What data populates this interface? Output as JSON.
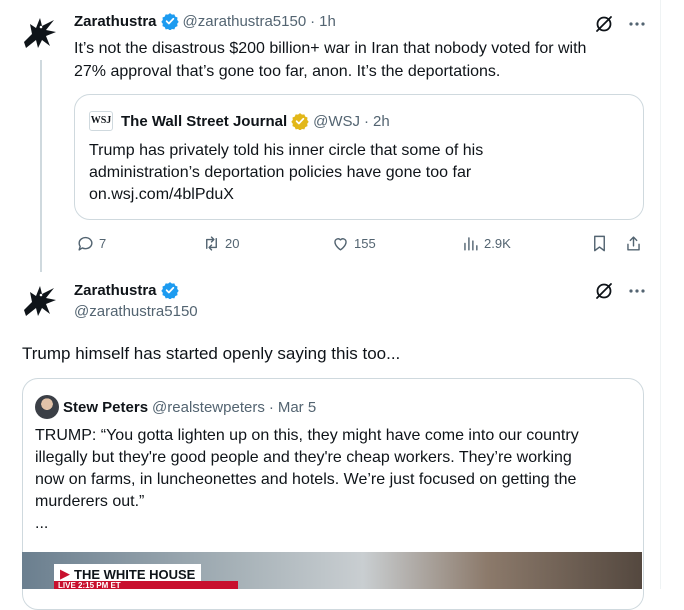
{
  "tweet1": {
    "name": "Zarathustra",
    "handle": "@zarathustra5150",
    "sep": "·",
    "time": "1h",
    "text_line1": "It’s not the disastrous $200 billion+ war in Iran that nobody voted for with",
    "text_line2": "27% approval that’s gone too far, anon. It’s the deportations.",
    "quote": {
      "logo_text": "WSJ",
      "name": "The Wall Street Journal",
      "handle": "@WSJ",
      "sep": "·",
      "time": "2h",
      "line1": "Trump has privately told his inner circle that some of his",
      "line2": "administration’s deportation policies have gone too far",
      "line3": "on.wsj.com/4blPduX"
    },
    "actions": {
      "replies": "7",
      "retweets": "20",
      "likes": "155",
      "views": "2.9K"
    }
  },
  "tweet2": {
    "name": "Zarathustra",
    "handle": "@zarathustra5150",
    "text": "Trump himself has started openly saying this too...",
    "quote": {
      "name": "Stew Peters",
      "handle": "@realstewpeters",
      "sep": "·",
      "time": "Mar 5",
      "line1": "TRUMP: “You gotta lighten up on this, they might have come into our country",
      "line2": "illegally but they're good people and they're cheap workers. They’re working",
      "line3": "now on farms, in luncheonettes and hotels. We’re just focused on getting the",
      "line4": "murderers out.”",
      "line5": "...",
      "media_banner": "THE WHITE HOUSE",
      "media_live": "LIVE  2:15 PM ET"
    }
  },
  "icons": [
    "raven-avatar",
    "verified-badge-blue",
    "verified-badge-gold",
    "grok-icon",
    "more-icon",
    "reply-icon",
    "retweet-icon",
    "like-icon",
    "views-icon",
    "bookmark-icon",
    "share-icon"
  ],
  "colors": {
    "verified_blue": "#1d9bf0",
    "verified_gold": "#e2b719",
    "muted": "#536471",
    "border": "#cfd9de",
    "text": "#0f1419"
  }
}
